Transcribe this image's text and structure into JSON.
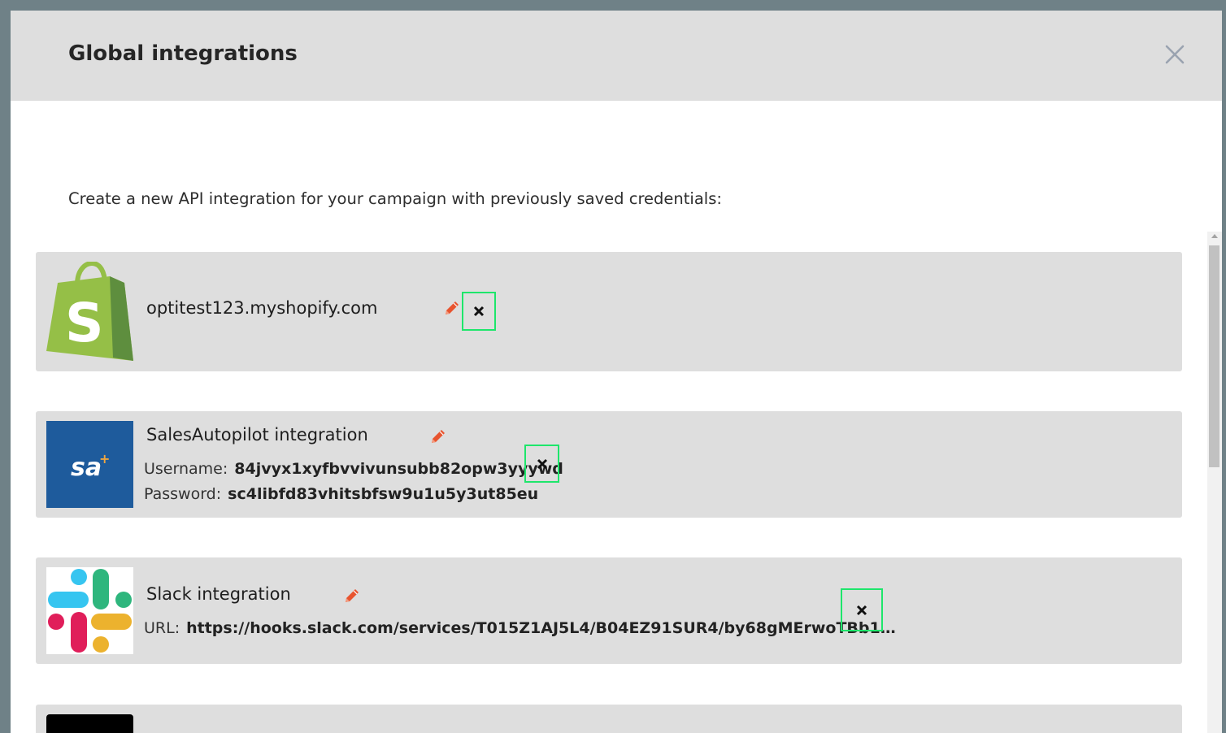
{
  "modal": {
    "title": "Global integrations",
    "intro": "Create a new API integration for your campaign with previously saved credentials:"
  },
  "integrations": [
    {
      "type": "shopify",
      "logo_icon": "shopify-logo-icon",
      "name": "optitest123.myshopify.com"
    },
    {
      "type": "salesautopilot",
      "logo_icon": "salesautopilot-logo-icon",
      "logo_text": "sa",
      "name": "SalesAutopilot integration",
      "fields": [
        {
          "label": "Username:",
          "value": "84jvyx1xyfbvvivunsubb82opw3yyywd"
        },
        {
          "label": "Password:",
          "value": "sc4libfd83vhitsbfsw9u1u5y3ut85eu"
        }
      ]
    },
    {
      "type": "slack",
      "logo_icon": "slack-logo-icon",
      "name": "Slack integration",
      "fields": [
        {
          "label": "URL:",
          "value": "https://hooks.slack.com/services/T015Z1AJ5L4/B04EZ91SUR4/by68gMErwoTBb1…"
        }
      ]
    }
  ],
  "colors": {
    "edit_icon": "#e8542f",
    "remove_highlight": "#1ee66b",
    "card_bg": "#dedede",
    "header_bg": "#dedede",
    "shopify_green": "#95bf47",
    "salesautopilot_blue": "#1e5b9c"
  }
}
